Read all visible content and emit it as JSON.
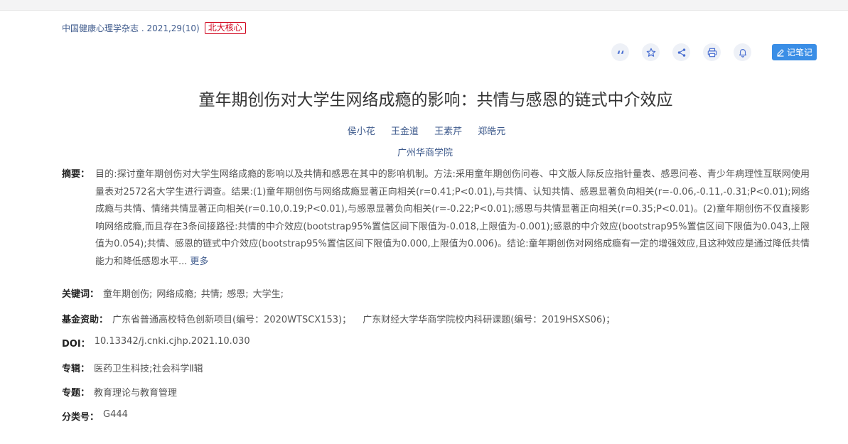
{
  "header": {
    "source": "中国健康心理学杂志 . 2021,29(10)",
    "badge": "北大核心"
  },
  "toolbar": {
    "icons": [
      "quote-icon",
      "star-icon",
      "share-icon",
      "print-icon",
      "bell-icon"
    ],
    "note_label": "记笔记",
    "accent": "#3a8ee6"
  },
  "article": {
    "title": "童年期创伤对大学生网络成瘾的影响：共情与感恩的链式中介效应",
    "authors": [
      "侯小花",
      "王金道",
      "王素芹",
      "郑皓元"
    ],
    "affiliation": "广州华商学院"
  },
  "abstract": {
    "label": "摘要：",
    "text": "目的:探讨童年期创伤对大学生网络成瘾的影响以及共情和感恩在其中的影响机制。方法:采用童年期创伤问卷、中文版人际反应指针量表、感恩问卷、青少年病理性互联网使用量表对2572名大学生进行调查。结果:(1)童年期创伤与网络成瘾显著正向相关(r=0.41;P<0.01),与共情、认知共情、感恩显著负向相关(r=-0.06,-0.11,-0.31;P<0.01);网络成瘾与共情、情绪共情显著正向相关(r=0.10,0.19;P<0.01),与感恩显著负向相关(r=-0.22;P<0.01);感恩与共情显著正向相关(r=0.35;P<0.01)。(2)童年期创伤不仅直接影响网络成瘾,而且存在3条间接路径:共情的中介效应(bootstrap95%置信区间下限值为-0.018,上限值为-0.001);感恩的中介效应(bootstrap95%置信区间下限值为0.043,上限值为0.054);共情、感恩的链式中介效应(bootstrap95%置信区间下限值为0.000,上限值为0.006)。结论:童年期创伤对网络成瘾有一定的增强效应,且这种效应是通过降低共情能力和降低感恩水平...",
    "more": "更多"
  },
  "keywords": {
    "label": "关键词：",
    "items": [
      "童年期创伤;",
      "网络成瘾;",
      "共情;",
      "感恩;",
      "大学生;"
    ]
  },
  "fund": {
    "label": "基金资助：",
    "items": [
      "广东省普通高校特色创新项目(编号：2020WTSCX153)；",
      "广东财经大学华商学院校内科研课题(编号：2019HSXS06)；"
    ]
  },
  "doi": {
    "label": "DOI：",
    "value": "10.13342/j.cnki.cjhp.2021.10.030"
  },
  "series": {
    "label": "专辑：",
    "value": "医药卫生科技;社会科学Ⅱ辑"
  },
  "topic": {
    "label": "专题：",
    "value": "教育理论与教育管理"
  },
  "classification": {
    "label": "分类号：",
    "value": "G444"
  }
}
